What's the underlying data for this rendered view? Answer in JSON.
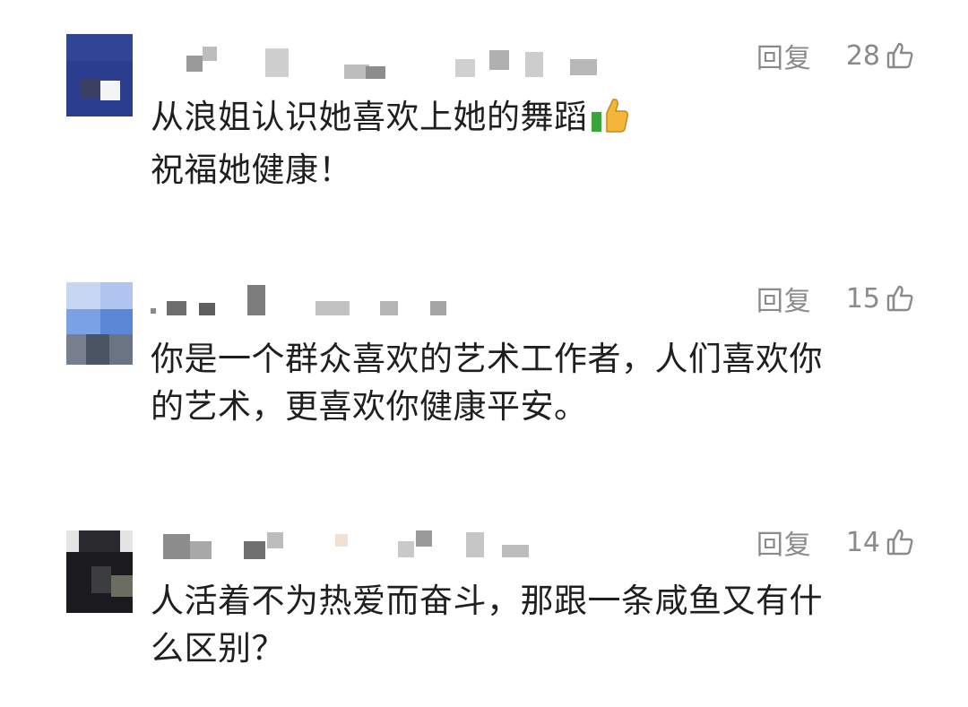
{
  "comments": [
    {
      "reply_label": "回复",
      "likes": "28",
      "line1": "从浪姐认识她喜欢上她的舞蹈",
      "line2": "祝福她健康！",
      "emoji": "thumbs-up-emoji"
    },
    {
      "reply_label": "回复",
      "likes": "15",
      "line1": "你是一个群众喜欢的艺术工作者，人们喜欢你",
      "line2": "的艺术，更喜欢你健康平安。"
    },
    {
      "reply_label": "回复",
      "likes": "14",
      "line1": "人活着不为热爱而奋斗，那跟一条咸鱼又有什",
      "line2": "么区别？"
    }
  ],
  "icons": {
    "like": "thumbs-up-outline-icon"
  },
  "colors": {
    "muted": "#8a8a8a",
    "text": "#1f1f1f"
  }
}
